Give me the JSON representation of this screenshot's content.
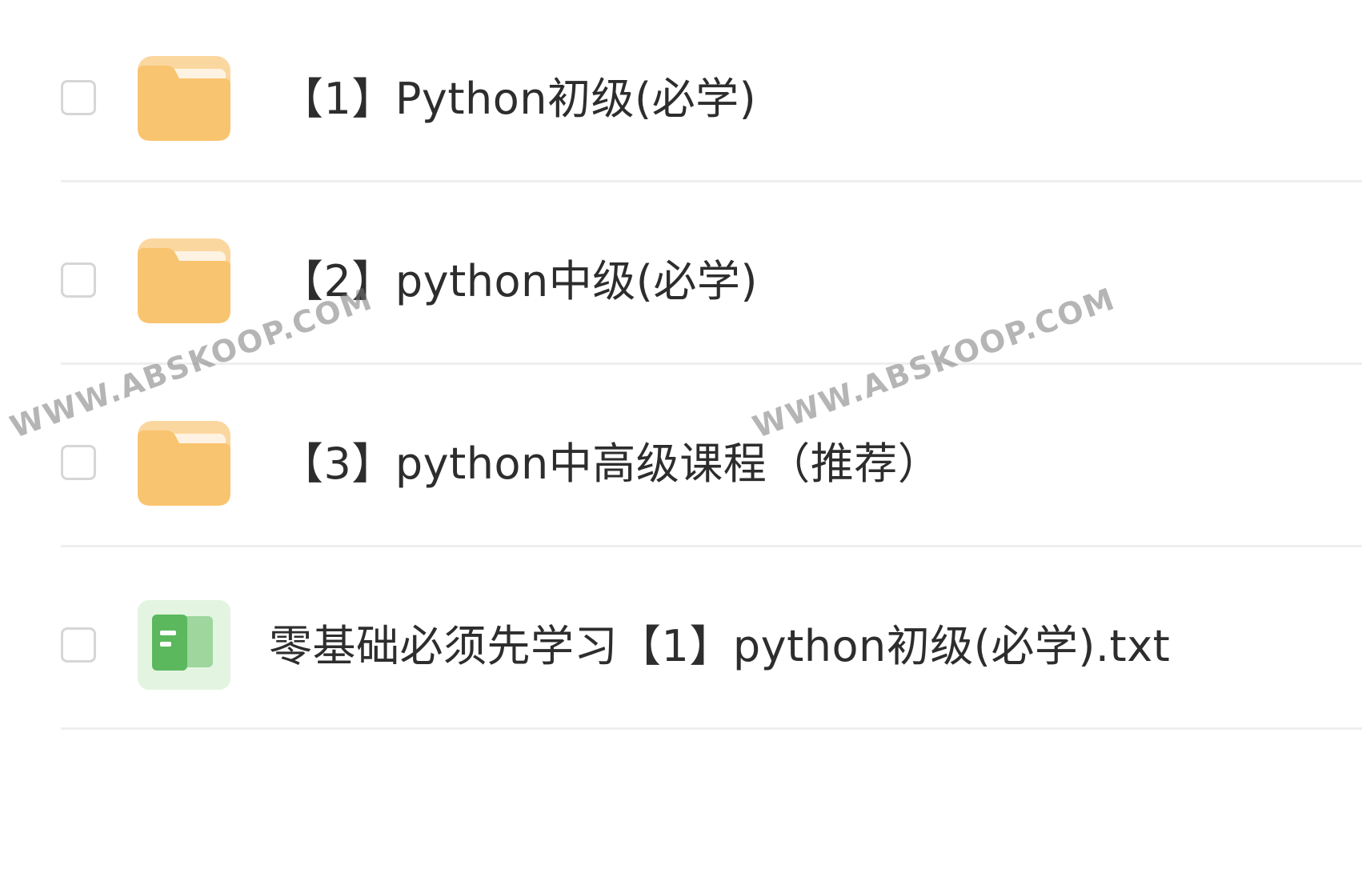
{
  "files": [
    {
      "name": "【1】Python初级(必学)",
      "type": "folder",
      "icon": "folder-icon"
    },
    {
      "name": "【2】python中级(必学)",
      "type": "folder",
      "icon": "folder-icon"
    },
    {
      "name": "【3】python中高级课程（推荐）",
      "type": "folder",
      "icon": "folder-icon"
    },
    {
      "name": "零基础必须先学习【1】python初级(必学).txt",
      "type": "txt",
      "icon": "text-file-icon"
    }
  ],
  "watermark": {
    "text": "WWW.ABSKOOP.COM"
  },
  "colors": {
    "folder": "#f9c46f",
    "folder_tab": "#fde7c4",
    "file_green": "#5bb85d",
    "file_bg": "#e3f5e1",
    "text": "#2d2d2d"
  }
}
